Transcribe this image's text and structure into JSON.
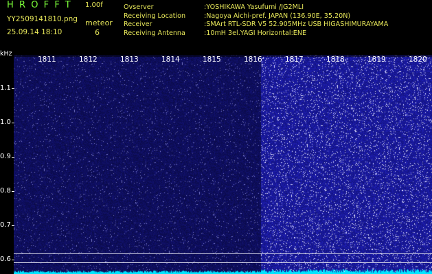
{
  "header": {
    "logo": "HROFFT",
    "version": "1.00f",
    "filename": "YY2509141810.png",
    "datetime": "25.09.14 18:10",
    "meteor_label": "meteor",
    "meteor_count": "6"
  },
  "meta": [
    {
      "key": "Ovserver",
      "value": ":YOSHIKAWA Yasufumi /JG2MLI"
    },
    {
      "key": "Receiving Location",
      "value": ":Nagoya Aichi-pref. JAPAN (136.90E, 35.20N)"
    },
    {
      "key": "Receiver",
      "value": ":SMArt RTL-SDR V5 52.905MHz USB HIGASHIMURAYAMA"
    },
    {
      "key": "Receiving Antenna",
      "value": ":10mH 3el.YAGI Horizontal:ENE"
    }
  ],
  "axis": {
    "unit": "kHz",
    "y_ticks": [
      "1.1",
      "1.0",
      "0.9",
      "0.8",
      "0.7",
      "0.6"
    ],
    "x_ticks": [
      "1811",
      "1812",
      "1813",
      "1814",
      "1815",
      "1816",
      "1817",
      "1818",
      "1819",
      "1820"
    ]
  },
  "colors": {
    "background": "#000000",
    "spectrum_low": "#11116a",
    "spectrum_bright": "#1b1bb0",
    "signal": "#00e5ff",
    "header_text": "#e8e85a",
    "logo": "#7dff3a"
  }
}
